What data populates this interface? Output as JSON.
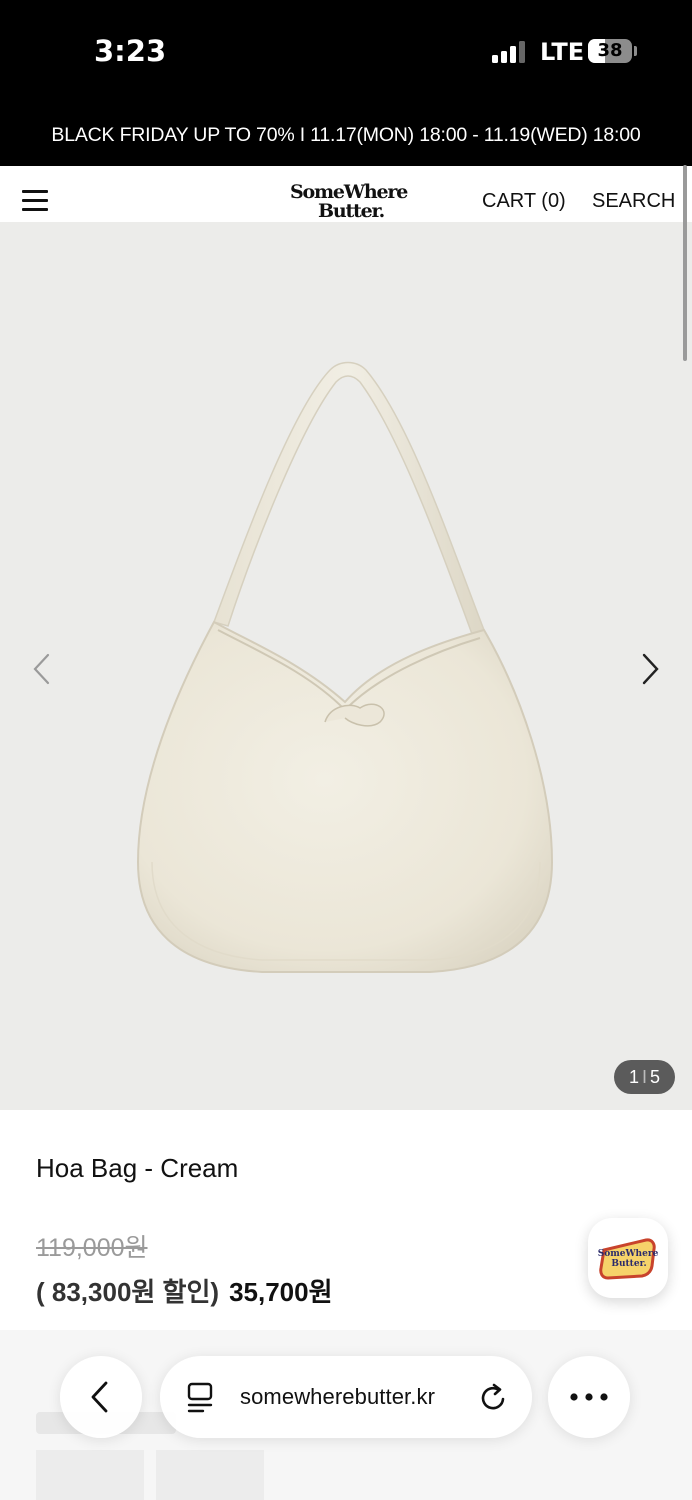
{
  "status_bar": {
    "time": "3:23",
    "network": "LTE",
    "battery": "38",
    "battery_level": 0.38
  },
  "promo": {
    "text": "BLACK FRIDAY UP TO 70% I 11.17(MON) 18:00 - 11.19(WED) 18:00"
  },
  "header": {
    "menu_icon": "hamburger-menu-icon",
    "logo_line1": "SomeWhere",
    "logo_line2": "Butter.",
    "cart_label": "CART (0)",
    "search_label": "SEARCH"
  },
  "gallery": {
    "counter_current": "1",
    "counter_separator": "I",
    "counter_total": "5",
    "prev_icon": "chevron-left-icon",
    "next_icon": "chevron-right-icon",
    "background": "#ececea",
    "bag_color": "#eeeadd"
  },
  "product": {
    "title": "Hoa Bag - Cream",
    "original_price": "119,000원",
    "discount_text": "( 83,300원 할인)",
    "sale_price": "35,700원"
  },
  "badge": {
    "icon": "somewhere-butter-logo-icon",
    "logo_line1": "SomeWhere",
    "logo_line2": "Butter."
  },
  "browser": {
    "back_icon": "chevron-left-icon",
    "reader_icon": "reader-mode-icon",
    "url": "somewherebutter.kr",
    "reload_icon": "reload-icon",
    "more_icon": "more-dots-icon"
  }
}
